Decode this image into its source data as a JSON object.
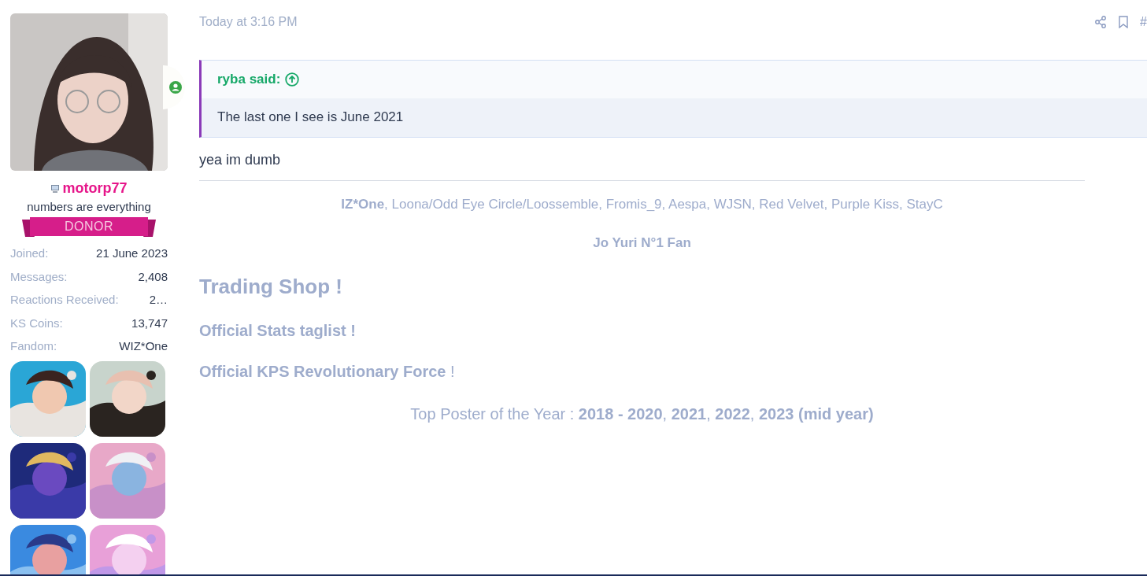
{
  "user": {
    "online": true,
    "name": "motorp77",
    "title": "numbers are everything",
    "banner": "DONOR",
    "stats": [
      {
        "label": "Joined:",
        "value": "21 June 2023"
      },
      {
        "label": "Messages:",
        "value": "2,408"
      },
      {
        "label": "Reactions Received:",
        "value": "2…"
      },
      {
        "label": "KS Coins:",
        "value": "13,747"
      },
      {
        "label": "Fandom:",
        "value": "WIZ*One"
      }
    ]
  },
  "post": {
    "time": "Today at 3:16 PM",
    "number": "#",
    "quote": {
      "author": "ryba said:",
      "text": "The last one I see is June 2021"
    },
    "body": "yea im dumb"
  },
  "signature": [
    {
      "kind": "line",
      "text": "**IZ*One**, Loona/Odd Eye Circle/Loossemble, Fromis_9, Aespa, WJSN, Red Velvet, Purple Kiss, StayC"
    },
    {
      "kind": "bold",
      "text": "Jo Yuri N°1 Fan"
    },
    {
      "kind": "heading",
      "text": "Trading Shop !"
    },
    {
      "kind": "link",
      "text": "Official Stats taglist !"
    },
    {
      "kind": "link",
      "text": "**Official KPS Revolutionary Force** !"
    },
    {
      "kind": "big",
      "text": "Top Poster of the Year : **2018 - 2020**, **2021**, **2022**, **2023 (mid year)**"
    }
  ]
}
